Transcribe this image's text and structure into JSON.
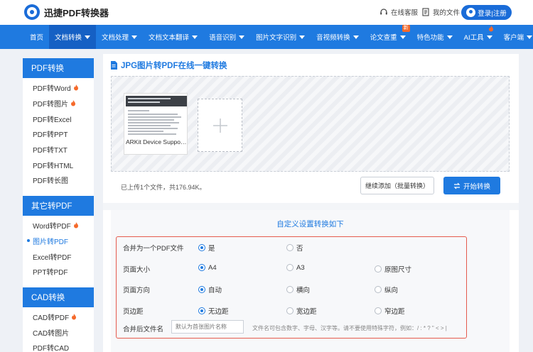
{
  "header": {
    "logo_text": "迅捷PDF转换器",
    "support": "在线客服",
    "my_files": "我的文件",
    "login": "登录|注册"
  },
  "nav": {
    "items": [
      {
        "label": "首页",
        "caret": false
      },
      {
        "label": "文档转换",
        "caret": true,
        "active": true
      },
      {
        "label": "文档处理",
        "caret": true
      },
      {
        "label": "文档文本翻译",
        "caret": true
      },
      {
        "label": "语音识别",
        "caret": true
      },
      {
        "label": "图片文字识别",
        "caret": true
      },
      {
        "label": "音视频转换",
        "caret": true
      },
      {
        "label": "论文查重",
        "caret": true,
        "badge": "新"
      },
      {
        "label": "特色功能",
        "caret": true
      },
      {
        "label": "AI工具",
        "caret": true,
        "fire": true
      },
      {
        "label": "客户端",
        "caret": true
      }
    ]
  },
  "sidebar": {
    "sections": [
      {
        "title": "PDF转换",
        "items": [
          {
            "label": "PDF转Word",
            "hot": true
          },
          {
            "label": "PDF转图片",
            "hot": true
          },
          {
            "label": "PDF转Excel"
          },
          {
            "label": "PDF转PPT"
          },
          {
            "label": "PDF转TXT"
          },
          {
            "label": "PDF转HTML"
          },
          {
            "label": "PDF转长图"
          }
        ]
      },
      {
        "title": "其它转PDF",
        "items": [
          {
            "label": "Word转PDF",
            "hot": true
          },
          {
            "label": "图片转PDF",
            "active": true
          },
          {
            "label": "Excel转PDF"
          },
          {
            "label": "PPT转PDF"
          }
        ]
      },
      {
        "title": "CAD转换",
        "items": [
          {
            "label": "CAD转PDF",
            "hot": true
          },
          {
            "label": "CAD转图片"
          },
          {
            "label": "PDF转CAD"
          }
        ]
      }
    ]
  },
  "main": {
    "title": "JPG图片转PDF在线一键转换",
    "file_caption": "ARKit Device Supporting...",
    "thumb_title": "Verifying Device Support and User Permissions",
    "upload_info": "已上传1个文件，共176.94K。",
    "continue_btn": "继续添加（批量转换）",
    "start_btn": "开始转换"
  },
  "settings": {
    "title": "自定义设置转换如下",
    "rows": [
      {
        "label": "合并为一个PDF文件",
        "options": [
          "是",
          "否"
        ],
        "selected": 0
      },
      {
        "label": "页面大小",
        "options": [
          "A4",
          "A3",
          "原图尺寸"
        ],
        "selected": 0
      },
      {
        "label": "页面方向",
        "options": [
          "自动",
          "横向",
          "纵向"
        ],
        "selected": 0
      },
      {
        "label": "页边距",
        "options": [
          "无边距",
          "宽边距",
          "窄边距"
        ],
        "selected": 0
      }
    ],
    "filename": {
      "label": "合并后文件名",
      "placeholder": "默认为首张图片名称",
      "hint": "文件名可包含数字、字母、汉字等。请不要使用特殊字符，例如：/ : * ? \" < > |"
    }
  },
  "colors": {
    "primary": "#1f7ae0",
    "accent_red": "#e55b4d",
    "hot": "#f5692a"
  }
}
